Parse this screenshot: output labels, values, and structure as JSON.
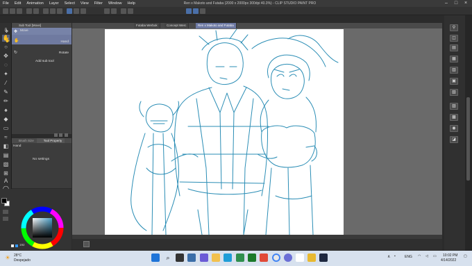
{
  "menu": [
    "File",
    "Edit",
    "Animation",
    "Layer",
    "Select",
    "View",
    "Filter",
    "Window",
    "Help"
  ],
  "title": "Ren x Makoto and Futaba (2000 x 2000px 300dpi 40.3%)  - CLIP STUDIO PAINT PRO",
  "document_tabs": [
    "Futaba Werbok",
    "Concept Werc",
    "Ren x Makoto and Futaba"
  ],
  "subtool": {
    "tab_label": "Sub Tool [Move]",
    "items": [
      {
        "label": "Move"
      },
      {
        "label": "Hand"
      },
      {
        "label": "Rotate"
      }
    ],
    "add_label": "Add sub tool"
  },
  "tool_property": {
    "tabs": [
      "Brush Size",
      "Tool Property"
    ],
    "tool_name": "Hand",
    "no_settings": "No settings"
  },
  "color": {
    "main_color": "#000000",
    "sub_color": "#ffffff",
    "readout": "192"
  },
  "sketch": {
    "line_color": "#2a8db5"
  },
  "taskbar": {
    "weather_temp": "28°C",
    "weather_desc": "Despejado",
    "lang": "ENG",
    "time": "10:02 PM",
    "date": "4/14/2022",
    "colors": {
      "bar": "#d7e1ee"
    }
  },
  "colors": {
    "menu_bg": "#3a3a3a",
    "panel_bg": "#3c3c3c",
    "accent": "#6d79a3",
    "canvas_bg": "#6a6a6a"
  }
}
